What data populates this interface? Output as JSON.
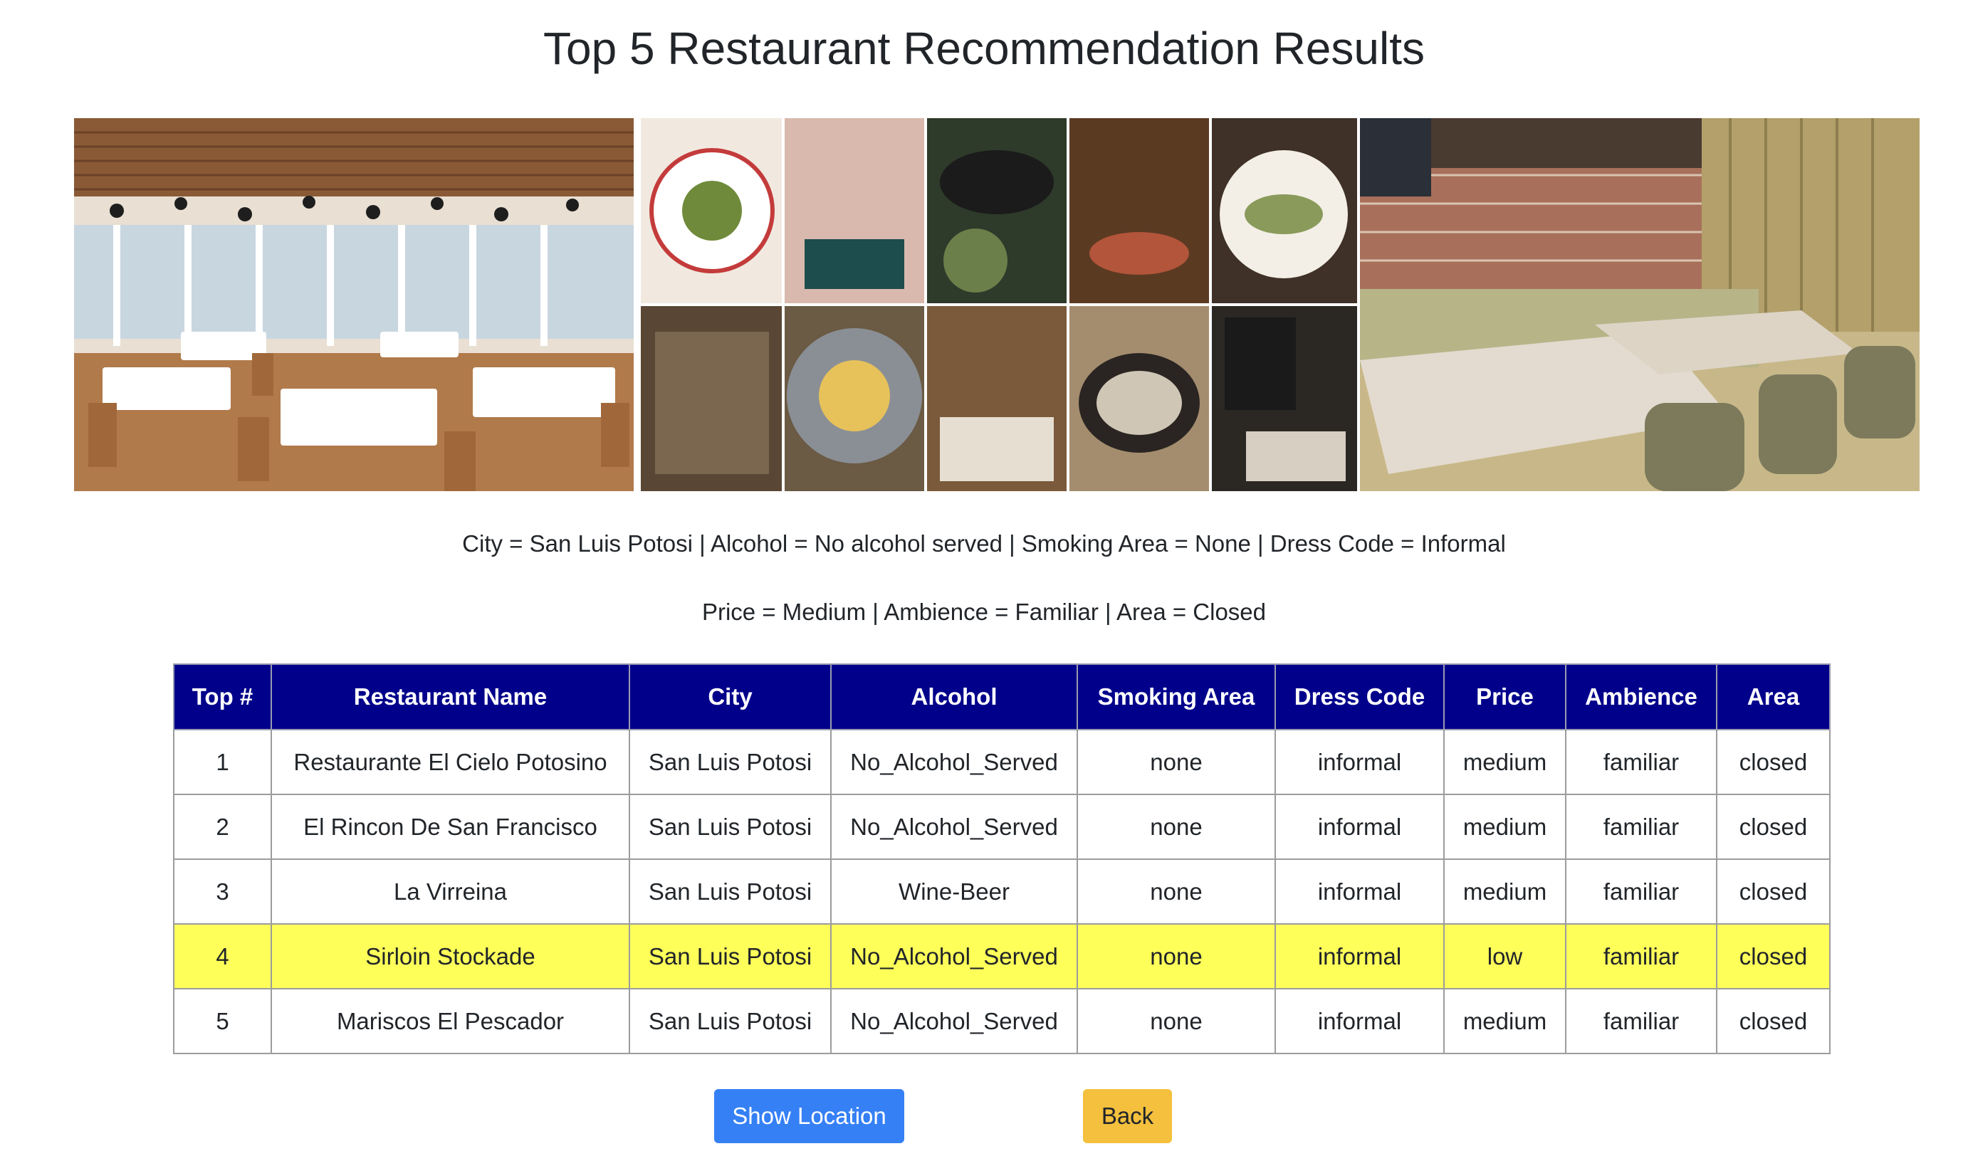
{
  "page": {
    "title": "Top 5 Restaurant Recommendation Results"
  },
  "banner": {
    "images": [
      "restaurant-dining-room-photo",
      "restaurant-food-collage-photo",
      "restaurant-booth-seating-photo"
    ]
  },
  "filters": {
    "line1": "City = San Luis Potosi | Alcohol = No alcohol served | Smoking Area = None | Dress Code = Informal",
    "line2": "Price = Medium | Ambience = Familiar | Area = Closed"
  },
  "table": {
    "headers": [
      "Top #",
      "Restaurant Name",
      "City",
      "Alcohol",
      "Smoking Area",
      "Dress Code",
      "Price",
      "Ambience",
      "Area"
    ],
    "rows": [
      [
        "1",
        "Restaurante El Cielo Potosino",
        "San Luis Potosi",
        "No_Alcohol_Served",
        "none",
        "informal",
        "medium",
        "familiar",
        "closed"
      ],
      [
        "2",
        "El Rincon De San Francisco",
        "San Luis Potosi",
        "No_Alcohol_Served",
        "none",
        "informal",
        "medium",
        "familiar",
        "closed"
      ],
      [
        "3",
        "La Virreina",
        "San Luis Potosi",
        "Wine-Beer",
        "none",
        "informal",
        "medium",
        "familiar",
        "closed"
      ],
      [
        "4",
        "Sirloin Stockade",
        "San Luis Potosi",
        "No_Alcohol_Served",
        "none",
        "informal",
        "low",
        "familiar",
        "closed"
      ],
      [
        "5",
        "Mariscos El Pescador",
        "San Luis Potosi",
        "No_Alcohol_Served",
        "none",
        "informal",
        "medium",
        "familiar",
        "closed"
      ]
    ],
    "highlighted_row_rank": "4",
    "colors": {
      "header_bg": "#00008b",
      "highlight_bg": "#ffff5a"
    }
  },
  "buttons": {
    "show_location": "Show Location",
    "back": "Back",
    "colors": {
      "show_location_bg": "#3580f5",
      "back_bg": "#f4c03d"
    }
  }
}
